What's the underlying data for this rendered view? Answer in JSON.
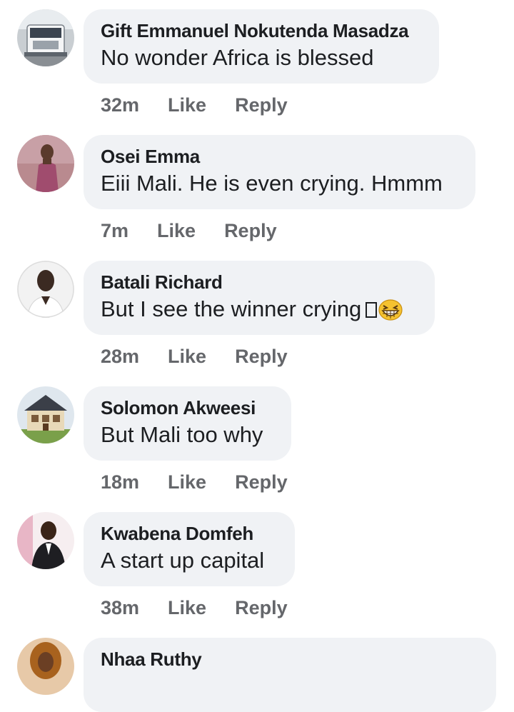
{
  "comments": [
    {
      "name": "Gift Emmanuel Nokutenda Masadza",
      "text": "No  wonder Africa is blessed",
      "time": "32m",
      "like": "Like",
      "reply": "Reply",
      "avatar": "truck-avatar"
    },
    {
      "name": "Osei Emma",
      "text": "Eiii Mali. He is even crying. Hmmm",
      "time": "7m",
      "like": "Like",
      "reply": "Reply",
      "avatar": "person-avatar"
    },
    {
      "name": "Batali Richard",
      "text": "But I see the winner crying",
      "emoji": "grinning-squinting-face-icon",
      "time": "28m",
      "like": "Like",
      "reply": "Reply",
      "avatar": "person-avatar"
    },
    {
      "name": "Solomon Akweesi",
      "text": "But Mali too why",
      "time": "18m",
      "like": "Like",
      "reply": "Reply",
      "avatar": "house-avatar"
    },
    {
      "name": "Kwabena Domfeh",
      "text": "A start up capital",
      "time": "38m",
      "like": "Like",
      "reply": "Reply",
      "avatar": "person-avatar"
    },
    {
      "name": "Nhaa Ruthy",
      "avatar": "person-avatar"
    }
  ],
  "colors": {
    "bubble": "#f0f2f5",
    "text": "#1c1e21",
    "meta": "#65676b"
  }
}
